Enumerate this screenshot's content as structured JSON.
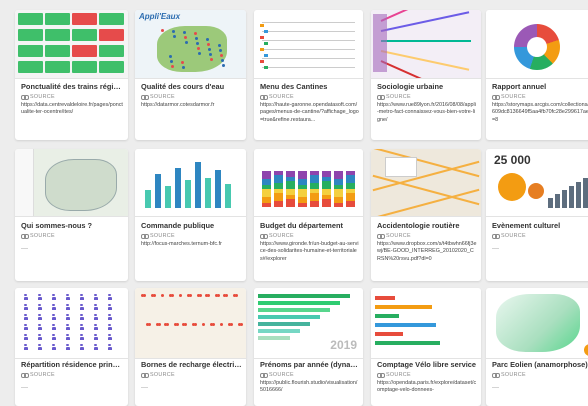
{
  "source_label": "SOURCE",
  "cards": [
    {
      "title": "Ponctualité des trains région...",
      "url": "https://data.centrevaldeloire.fr/pages/ponctualite-ter-ocentre/ites/",
      "thumb": "tiles"
    },
    {
      "title": "Qualité des cours d'eau",
      "url": "https://datarmor.cotesdarmor.fr",
      "thumb": "eaux",
      "brand": "Appli'Eaux"
    },
    {
      "title": "Menu des Cantines",
      "url": "https://haute-garonne.opendatasoft.com/pages/menus-de-cantine/?affichage_logo=true&refine.restaura...",
      "thumb": "menu"
    },
    {
      "title": "Sociologie urbaine",
      "url": "https://www.rue89lyon.fr/2016/08/08/appli-metro-fact-connaissez-vous-bien-votre-ligne/",
      "thumb": "metro"
    },
    {
      "title": "Rapport annuel",
      "url": "https://storymaps.arcgis.com/collections/c609dc8136649f5aa4fb70fc28e299617aem=8",
      "thumb": "donut"
    },
    {
      "title": "Qui sommes-nous ?",
      "url": "",
      "thumb": "whomap"
    },
    {
      "title": "Commande publique",
      "url": "http://focus-marches.ternum-bfc.fr",
      "thumb": "bars"
    },
    {
      "title": "Budget du département",
      "url": "https://www.gironde.fr/un-budget-au-service-des-solidarites-humaine-et-territoriales#/explorer",
      "thumb": "stack"
    },
    {
      "title": "Accidentologie routière",
      "url": "https://www.dropbox.com/s/t4tbwhn66fj3ewj/BE-GOOD_INTERREG_20102020_CRSN%20rsvu.pdf?dl=0",
      "thumb": "road"
    },
    {
      "title": "Evènement culturel",
      "url": "",
      "thumb": "culture",
      "big_number": "25 000"
    },
    {
      "title": "Répartition résidence princip...",
      "url": "",
      "thumb": "people"
    },
    {
      "title": "Bornes de recharge électrique",
      "url": "",
      "thumb": "redmap"
    },
    {
      "title": "Prénoms par année (dynamiq...",
      "url": "https://public.flourish.studio/visualisation/5016666/",
      "thumb": "race",
      "year": "2019"
    },
    {
      "title": "Comptage Vélo libre service",
      "url": "https://opendata.paris.fr/explore/dataset/comptage-velo-donnees-",
      "thumb": "velo"
    },
    {
      "title": "Parc Eolien (anamorphose)",
      "url": "",
      "thumb": "eolien"
    }
  ],
  "colors": {
    "green": "#3fbf6a",
    "red": "#e64b4b",
    "orange": "#f39c12",
    "purple": "#6a5acd"
  }
}
